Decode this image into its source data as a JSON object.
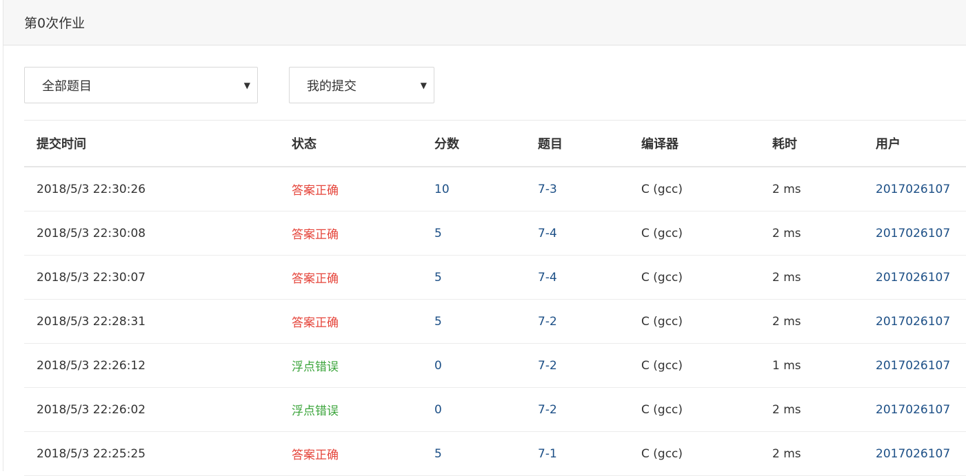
{
  "header": {
    "title": "第0次作业"
  },
  "filters": {
    "problem_select": {
      "value": "全部题目"
    },
    "scope_select": {
      "value": "我的提交"
    }
  },
  "table": {
    "columns": [
      "提交时间",
      "状态",
      "分数",
      "题目",
      "编译器",
      "耗时",
      "用户"
    ],
    "rows": [
      {
        "time": "2018/5/3 22:30:26",
        "status": "答案正确",
        "status_color": "#e5453b",
        "score": "10",
        "problem": "7-3",
        "compiler": "C (gcc)",
        "elapsed": "2 ms",
        "user": "2017026107"
      },
      {
        "time": "2018/5/3 22:30:08",
        "status": "答案正确",
        "status_color": "#e5453b",
        "score": "5",
        "problem": "7-4",
        "compiler": "C (gcc)",
        "elapsed": "2 ms",
        "user": "2017026107"
      },
      {
        "time": "2018/5/3 22:30:07",
        "status": "答案正确",
        "status_color": "#e5453b",
        "score": "5",
        "problem": "7-4",
        "compiler": "C (gcc)",
        "elapsed": "2 ms",
        "user": "2017026107"
      },
      {
        "time": "2018/5/3 22:28:31",
        "status": "答案正确",
        "status_color": "#e5453b",
        "score": "5",
        "problem": "7-2",
        "compiler": "C (gcc)",
        "elapsed": "2 ms",
        "user": "2017026107"
      },
      {
        "time": "2018/5/3 22:26:12",
        "status": "浮点错误",
        "status_color": "#3aa43a",
        "score": "0",
        "problem": "7-2",
        "compiler": "C (gcc)",
        "elapsed": "1 ms",
        "user": "2017026107"
      },
      {
        "time": "2018/5/3 22:26:02",
        "status": "浮点错误",
        "status_color": "#3aa43a",
        "score": "0",
        "problem": "7-2",
        "compiler": "C (gcc)",
        "elapsed": "2 ms",
        "user": "2017026107"
      },
      {
        "time": "2018/5/3 22:25:25",
        "status": "答案正确",
        "status_color": "#e5453b",
        "score": "5",
        "problem": "7-1",
        "compiler": "C (gcc)",
        "elapsed": "2 ms",
        "user": "2017026107"
      }
    ]
  },
  "colors": {
    "link": "#1c4f86",
    "accepted": "#e5453b",
    "float_error": "#3aa43a"
  }
}
